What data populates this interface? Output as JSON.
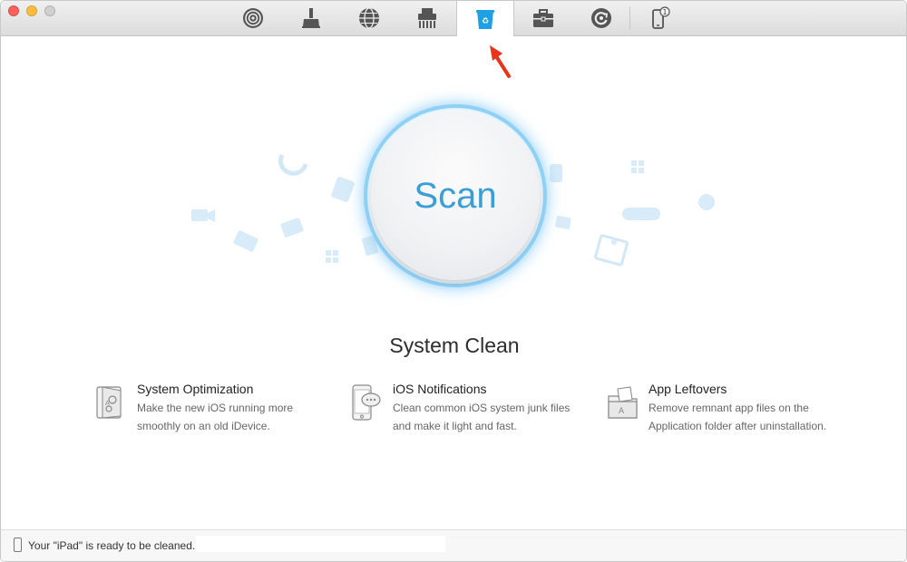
{
  "toolbar": {
    "tools": [
      {
        "icon": "airplay-icon",
        "active": false
      },
      {
        "icon": "broom-icon",
        "active": false
      },
      {
        "icon": "globe-icon",
        "active": false
      },
      {
        "icon": "shredder-icon",
        "active": false
      },
      {
        "icon": "recycle-bin-icon",
        "active": true
      },
      {
        "icon": "toolbox-icon",
        "active": false
      },
      {
        "icon": "backup-restore-icon",
        "active": false
      },
      {
        "icon": "iphone-device-icon",
        "active": false,
        "badge": "1"
      }
    ]
  },
  "scan": {
    "label": "Scan"
  },
  "section": {
    "title": "System Clean"
  },
  "features": [
    {
      "icon": "system-optimization-icon",
      "title": "System Optimization",
      "description": "Make the new iOS running more smoothly on an old iDevice."
    },
    {
      "icon": "ios-notifications-icon",
      "title": "iOS Notifications",
      "description": "Clean common iOS system junk files and make it light and fast."
    },
    {
      "icon": "app-leftovers-icon",
      "title": "App Leftovers",
      "description": "Remove remnant app files on the Application folder after uninstallation."
    }
  ],
  "status": {
    "message": "Your \"iPad\" is ready to be cleaned."
  },
  "colors": {
    "accent": "#3a9ed8",
    "ring": "#8fd0f5",
    "arrow": "#e8341c",
    "active_tool": "#1ea0e6"
  }
}
